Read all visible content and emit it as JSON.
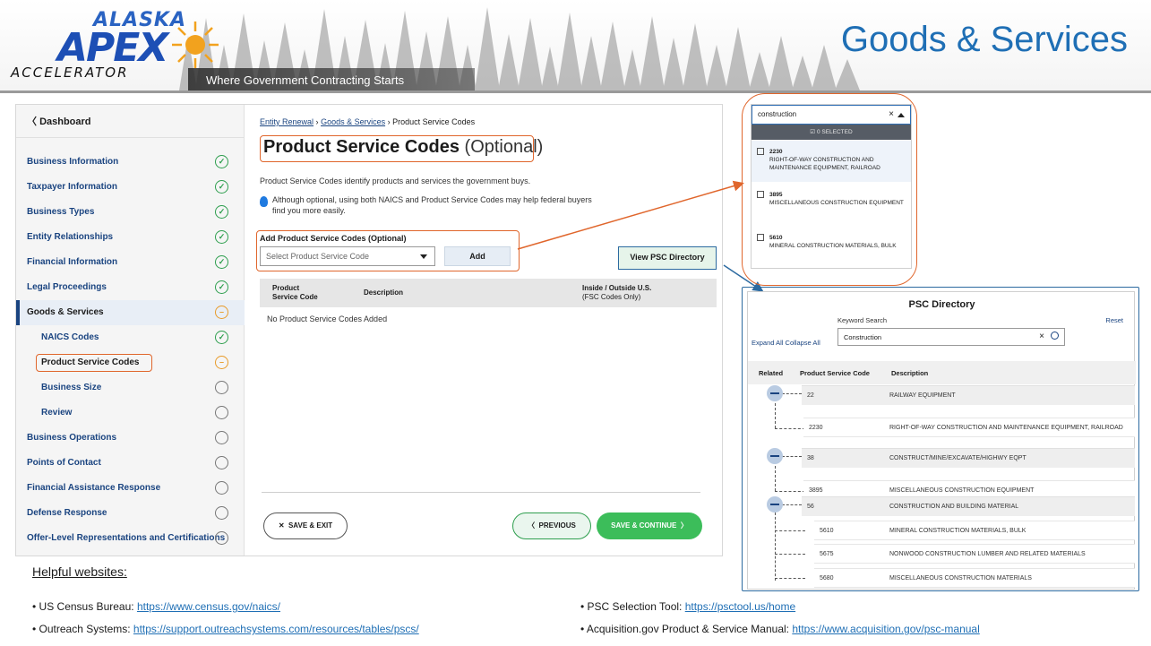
{
  "header": {
    "logo_top": "ALASKA",
    "logo_main": "APEX",
    "logo_bottom": "ACCELERATOR",
    "tagline": "Where Government Contracting Starts",
    "slide_title": "Goods & Services"
  },
  "sidebar": {
    "back_label": "Dashboard",
    "items": [
      {
        "label": "Business Information",
        "status": "done"
      },
      {
        "label": "Taxpayer Information",
        "status": "done"
      },
      {
        "label": "Business Types",
        "status": "done"
      },
      {
        "label": "Entity Relationships",
        "status": "done"
      },
      {
        "label": "Financial Information",
        "status": "done"
      },
      {
        "label": "Legal Proceedings",
        "status": "done"
      },
      {
        "label": "Goods & Services",
        "status": "partial"
      },
      {
        "label": "NAICS Codes",
        "status": "done"
      },
      {
        "label": "Product Service Codes",
        "status": "partial"
      },
      {
        "label": "Business Size",
        "status": "empty"
      },
      {
        "label": "Review",
        "status": "empty"
      },
      {
        "label": "Business Operations",
        "status": "empty"
      },
      {
        "label": "Points of Contact",
        "status": "empty"
      },
      {
        "label": "Financial Assistance Response",
        "status": "empty"
      },
      {
        "label": "Defense Response",
        "status": "empty"
      },
      {
        "label": "Offer-Level Representations and Certifications",
        "status": "empty"
      }
    ]
  },
  "main": {
    "breadcrumb": {
      "first": "Entity Renewal",
      "second": "Goods & Services",
      "current": "Product Service Codes",
      "sep": "›"
    },
    "heading": "Product Service Codes",
    "heading_suffix": "(Optional)",
    "description": "Product Service Codes identify products and services the government buys.",
    "tip": "Although optional, using both NAICS and Product Service Codes may help federal buyers find you more easily.",
    "add_label": "Add Product Service Codes (Optional)",
    "select_placeholder": "Select Product Service Code",
    "add_button": "Add",
    "view_dir_button": "View PSC Directory",
    "table_headers": {
      "code": "Product Service Code",
      "description": "Description",
      "inside": "Inside / Outside U.S.",
      "inside_sub": "(FSC Codes Only)"
    },
    "empty_text": "No Product Service Codes Added",
    "save_exit": "SAVE & EXIT",
    "previous": "PREVIOUS",
    "save_continue": "SAVE & CONTINUE"
  },
  "dropdown": {
    "query": "construction",
    "selected_count": "0 SELECTED",
    "options": [
      {
        "code": "2230",
        "name": "RIGHT-OF-WAY CONSTRUCTION AND MAINTENANCE EQUIPMENT, RAILROAD"
      },
      {
        "code": "3895",
        "name": "MISCELLANEOUS CONSTRUCTION EQUIPMENT"
      },
      {
        "code": "5610",
        "name": "MINERAL CONSTRUCTION MATERIALS, BULK"
      }
    ]
  },
  "directory": {
    "title": "PSC Directory",
    "keyword_label": "Keyword Search",
    "reset": "Reset",
    "expand_all": "Expand All",
    "collapse_all": "Collapse All",
    "search_value": "Construction",
    "columns": {
      "related": "Related",
      "code": "Product Service Code",
      "description": "Description"
    },
    "rows": [
      {
        "code": "22",
        "name": "RAILWAY EQUIPMENT",
        "kind": "group"
      },
      {
        "code": "2230",
        "name": "RIGHT-OF-WAY CONSTRUCTION AND MAINTENANCE EQUIPMENT, RAILROAD",
        "kind": "leaf"
      },
      {
        "code": "38",
        "name": "CONSTRUCT/MINE/EXCAVATE/HIGHWY EQPT",
        "kind": "group"
      },
      {
        "code": "3895",
        "name": "MISCELLANEOUS CONSTRUCTION EQUIPMENT",
        "kind": "leaf"
      },
      {
        "code": "56",
        "name": "CONSTRUCTION AND BUILDING MATERIAL",
        "kind": "group"
      },
      {
        "code": "5610",
        "name": "MINERAL CONSTRUCTION MATERIALS, BULK",
        "kind": "leaf"
      },
      {
        "code": "5675",
        "name": "NONWOOD CONSTRUCTION LUMBER AND RELATED MATERIALS",
        "kind": "leaf"
      },
      {
        "code": "5680",
        "name": "MISCELLANEOUS CONSTRUCTION MATERIALS",
        "kind": "leaf"
      }
    ]
  },
  "helpful": {
    "heading": "Helpful websites",
    "heading_suffix": ":",
    "links": [
      {
        "label": "• US Census Bureau: ",
        "url": "https://www.census.gov/naics/"
      },
      {
        "label": "• Outreach Systems: ",
        "url": "https://support.outreachsystems.com/resources/tables/pscs/"
      },
      {
        "label": "• PSC Selection Tool: ",
        "url": "https://psctool.us/home"
      },
      {
        "label": "• Acquisition.gov Product & Service Manual: ",
        "url": "https://www.acquisition.gov/psc-manual"
      }
    ]
  },
  "colors": {
    "title_blue": "#1f6fb5",
    "callout_orange": "#e0662c",
    "callout_blue": "#2c6aa0",
    "done_green": "#2e9e4e",
    "partial_amber": "#e89b2a"
  }
}
